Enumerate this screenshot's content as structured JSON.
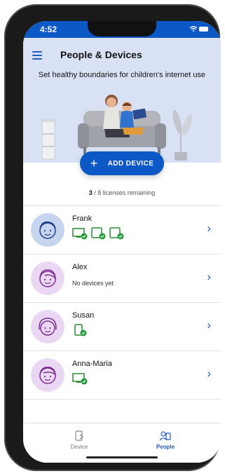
{
  "status": {
    "time": "4:52"
  },
  "header": {
    "title": "People & Devices",
    "subtitle": "Set healthy boundaries for children's internet use"
  },
  "add_device": {
    "label": "ADD DEVICE"
  },
  "licenses": {
    "count": "3",
    "text": " / 8 licenses remaining"
  },
  "people": [
    {
      "name": "Frank",
      "devices": [
        "monitor",
        "tablet",
        "tablet"
      ]
    },
    {
      "name": "Alex",
      "no_devices": "No devices yet"
    },
    {
      "name": "Susan",
      "devices": [
        "phone"
      ]
    },
    {
      "name": "Anna-Maria",
      "devices": [
        "monitor"
      ]
    }
  ],
  "tabs": {
    "device": "Device",
    "people": "People"
  },
  "colors": {
    "accent": "#0b58c6",
    "hero_bg": "#d9e2f5",
    "check_green": "#1f9d3a",
    "avatar_blue": "#c7d4f0",
    "avatar_purple": "#ead7f4"
  }
}
